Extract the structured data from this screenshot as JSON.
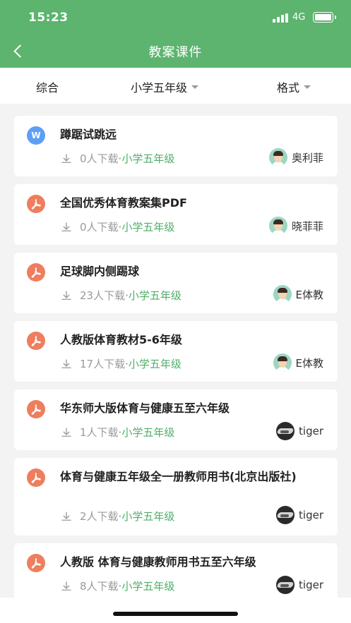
{
  "status": {
    "time": "15:23",
    "network": "4G"
  },
  "nav": {
    "title": "教案课件"
  },
  "filters": [
    {
      "label": "综合",
      "has_caret": false
    },
    {
      "label": "小学五年级",
      "has_caret": true
    },
    {
      "label": "格式",
      "has_caret": true
    }
  ],
  "items": [
    {
      "type": "word",
      "badge": "W",
      "title": "蹲踞试跳远",
      "downloads": "0人下载",
      "grade": "·小学五年级",
      "author": "奥利菲",
      "avatar": "person"
    },
    {
      "type": "pdf",
      "badge": "",
      "title": "全国优秀体育教案集PDF",
      "downloads": "0人下载",
      "grade": "·小学五年级",
      "author": "晓菲菲",
      "avatar": "person"
    },
    {
      "type": "pdf",
      "badge": "",
      "title": "足球脚内侧踢球",
      "downloads": "23人下载",
      "grade": "·小学五年级",
      "author": "E体教",
      "avatar": "person"
    },
    {
      "type": "pdf",
      "badge": "",
      "title": "人教版体育教材5-6年级",
      "downloads": "17人下载",
      "grade": "·小学五年级",
      "author": "E体教",
      "avatar": "person"
    },
    {
      "type": "pdf",
      "badge": "",
      "title": "华东师大版体育与健康五至六年级",
      "downloads": "1人下载",
      "grade": "·小学五年级",
      "author": "tiger",
      "avatar": "car"
    },
    {
      "type": "pdf",
      "badge": "",
      "title": "体育与健康五年级全一册教师用书(北京出版社)",
      "downloads": "2人下载",
      "grade": "·小学五年级",
      "author": "tiger",
      "avatar": "car"
    },
    {
      "type": "pdf",
      "badge": "",
      "title": "人教版 体育与健康教师用书五至六年级",
      "downloads": "8人下载",
      "grade": "·小学五年级",
      "author": "tiger",
      "avatar": "car"
    }
  ],
  "colors": {
    "header": "#5cb46f",
    "grade": "#4fae67",
    "pdf_icon": "#ee7e5d",
    "word_icon": "#5d9ff5"
  }
}
